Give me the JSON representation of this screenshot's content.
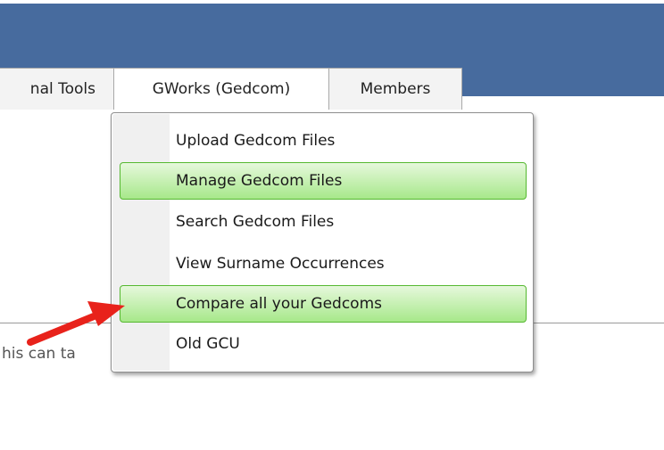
{
  "nav": {
    "tabs": [
      {
        "label": "nal Tools"
      },
      {
        "label": "GWorks (Gedcom)"
      },
      {
        "label": "Members"
      }
    ]
  },
  "dropdown": {
    "items": [
      {
        "label": "Upload Gedcom Files",
        "highlighted": false
      },
      {
        "label": "Manage Gedcom Files",
        "highlighted": true
      },
      {
        "label": "Search Gedcom Files",
        "highlighted": false
      },
      {
        "label": "View Surname Occurrences",
        "highlighted": false
      },
      {
        "label": "Compare all your Gedcoms",
        "highlighted": true
      },
      {
        "label": "Old GCU",
        "highlighted": false
      }
    ]
  },
  "content": {
    "partial_text": "his can ta"
  },
  "colors": {
    "header": "#476b9e",
    "highlight_border": "#55b830",
    "arrow": "#e8221b"
  },
  "annotation": {
    "icon": "red-arrow-icon"
  }
}
